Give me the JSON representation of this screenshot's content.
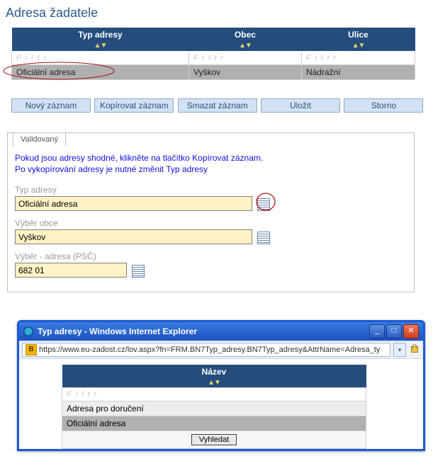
{
  "page_title": "Adresa žadatele",
  "table": {
    "headers": [
      "Typ adresy",
      "Obec",
      "Ulice"
    ],
    "filter_placeholder": "Filtr",
    "rows": [
      {
        "typ": "Oficiální adresa",
        "obec": "Vyškov",
        "ulice": "Nádražní"
      }
    ]
  },
  "buttons": {
    "new": "Nový záznam",
    "copy": "Kopírovat záznam",
    "delete": "Smazat záznam",
    "save": "Uložit",
    "cancel": "Storno"
  },
  "tab": {
    "label": "Validovaný"
  },
  "hint_line1": "Pokud jsou adresy shodné, klikněte na tlačítko Kopírovat záznam.",
  "hint_line2": "Po vykopírování adresy je nutné změnit Typ adresy",
  "fields": {
    "typ_label": "Typ adresy",
    "typ_value": "Oficiální adresa",
    "obec_label": "Výběr obce",
    "obec_value": "Vyškov",
    "psc_label": "Výběr - adresa (PSČ)",
    "psc_value": "682 01"
  },
  "popup": {
    "title": "Typ adresy - Windows Internet Explorer",
    "url": "https://www.eu-zadost.cz/lov.aspx?fn=FRM.BN7Typ_adresy.BN7Typ_adresy&AttrName=Adresa_ty",
    "lov_header": "Název",
    "filter_placeholder": "Filtr",
    "options": [
      "Adresa pro doručení",
      "Oficiální adresa"
    ],
    "search_btn": "Vyhledat"
  }
}
